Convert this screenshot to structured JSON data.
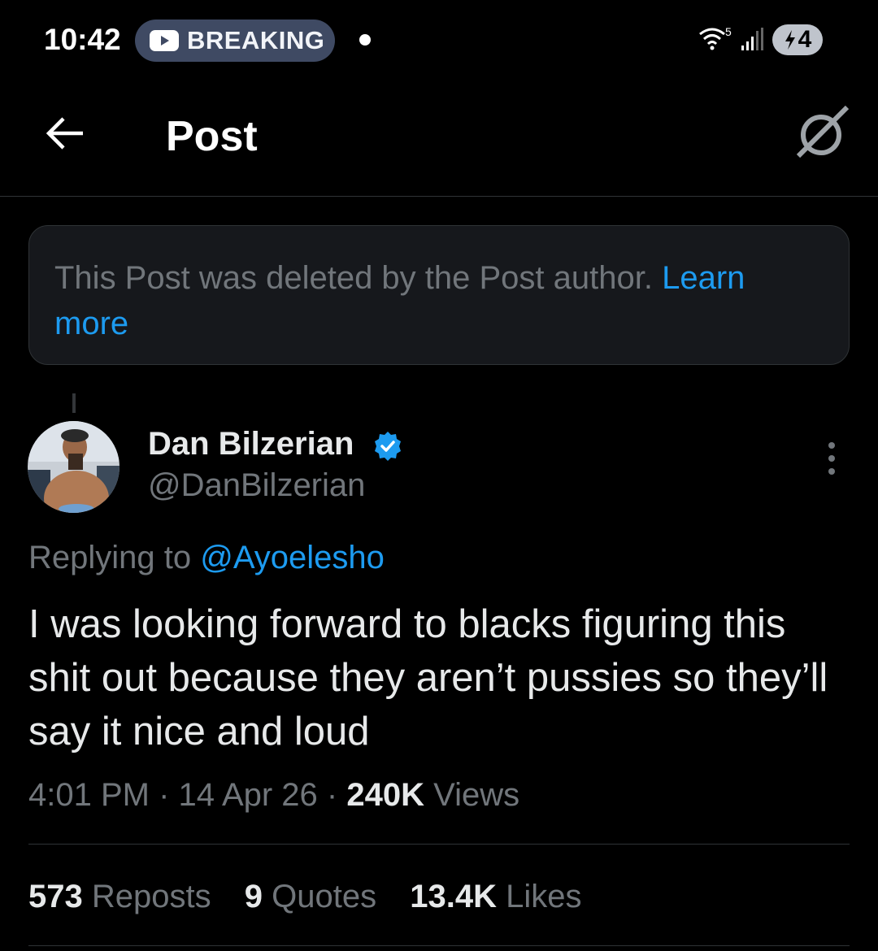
{
  "status_bar": {
    "time": "10:42",
    "notification_pill": {
      "label": "BREAKING",
      "icon": "youtube-play-icon"
    },
    "wifi_badge": "5",
    "battery_level": "4"
  },
  "header": {
    "title": "Post"
  },
  "notice": {
    "text": "This Post was deleted by the Post author. ",
    "link": "Learn more"
  },
  "post": {
    "author_name": "Dan Bilzerian",
    "author_handle": "@DanBilzerian",
    "replying_prefix": "Replying to ",
    "replying_to": "@Ayoelesho",
    "text": "I was looking forward to blacks figuring this shit out because they aren’t pussies so they’ll say it nice and loud",
    "time": "4:01 PM",
    "separator": "·",
    "date": "14 Apr 26",
    "views_count": "240K",
    "views_label": "Views"
  },
  "stats": [
    {
      "count": "573",
      "label": "Reposts"
    },
    {
      "count": "9",
      "label": "Quotes"
    },
    {
      "count": "13.4K",
      "label": "Likes"
    }
  ],
  "colors": {
    "background": "#000000",
    "text": "#e7e9ea",
    "secondary": "#71767b",
    "accent": "#1d9bf0"
  }
}
